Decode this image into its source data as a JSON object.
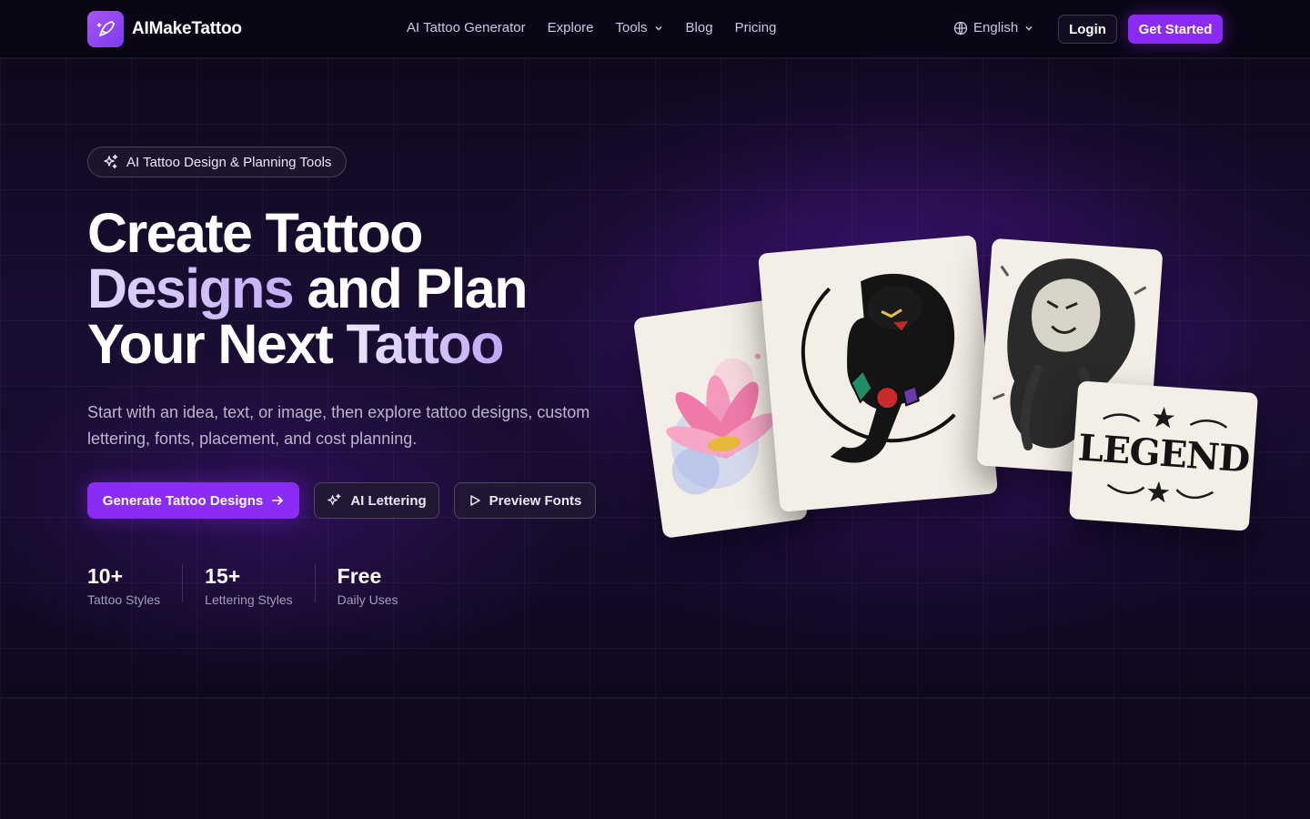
{
  "brand": {
    "name": "AIMakeTattoo",
    "accent": "#8b2cf5"
  },
  "nav": {
    "links": [
      "AI Tattoo Generator",
      "Explore",
      "Tools",
      "Blog",
      "Pricing"
    ],
    "language": "English",
    "login": "Login",
    "get_started": "Get Started"
  },
  "hero": {
    "badge": "AI Tattoo Design & Planning Tools",
    "headline": {
      "line1": "Create Tattoo",
      "line2_grad": "Designs",
      "line2_rest": " and Plan",
      "line3_plain": "Your Next ",
      "line3_grad": "Tattoo"
    },
    "subtitle": "Start with an idea, text, or image, then explore tattoo designs, custom lettering, fonts, placement, and cost planning.",
    "cta_primary": "Generate Tattoo Designs",
    "cta_lettering": "AI Lettering",
    "cta_fonts": "Preview Fonts",
    "stats": [
      {
        "value": "10+",
        "label": "Tattoo Styles"
      },
      {
        "value": "15+",
        "label": "Lettering Styles"
      },
      {
        "value": "Free",
        "label": "Daily Uses"
      }
    ]
  },
  "gallery": {
    "legend_text": "LEGEND"
  }
}
